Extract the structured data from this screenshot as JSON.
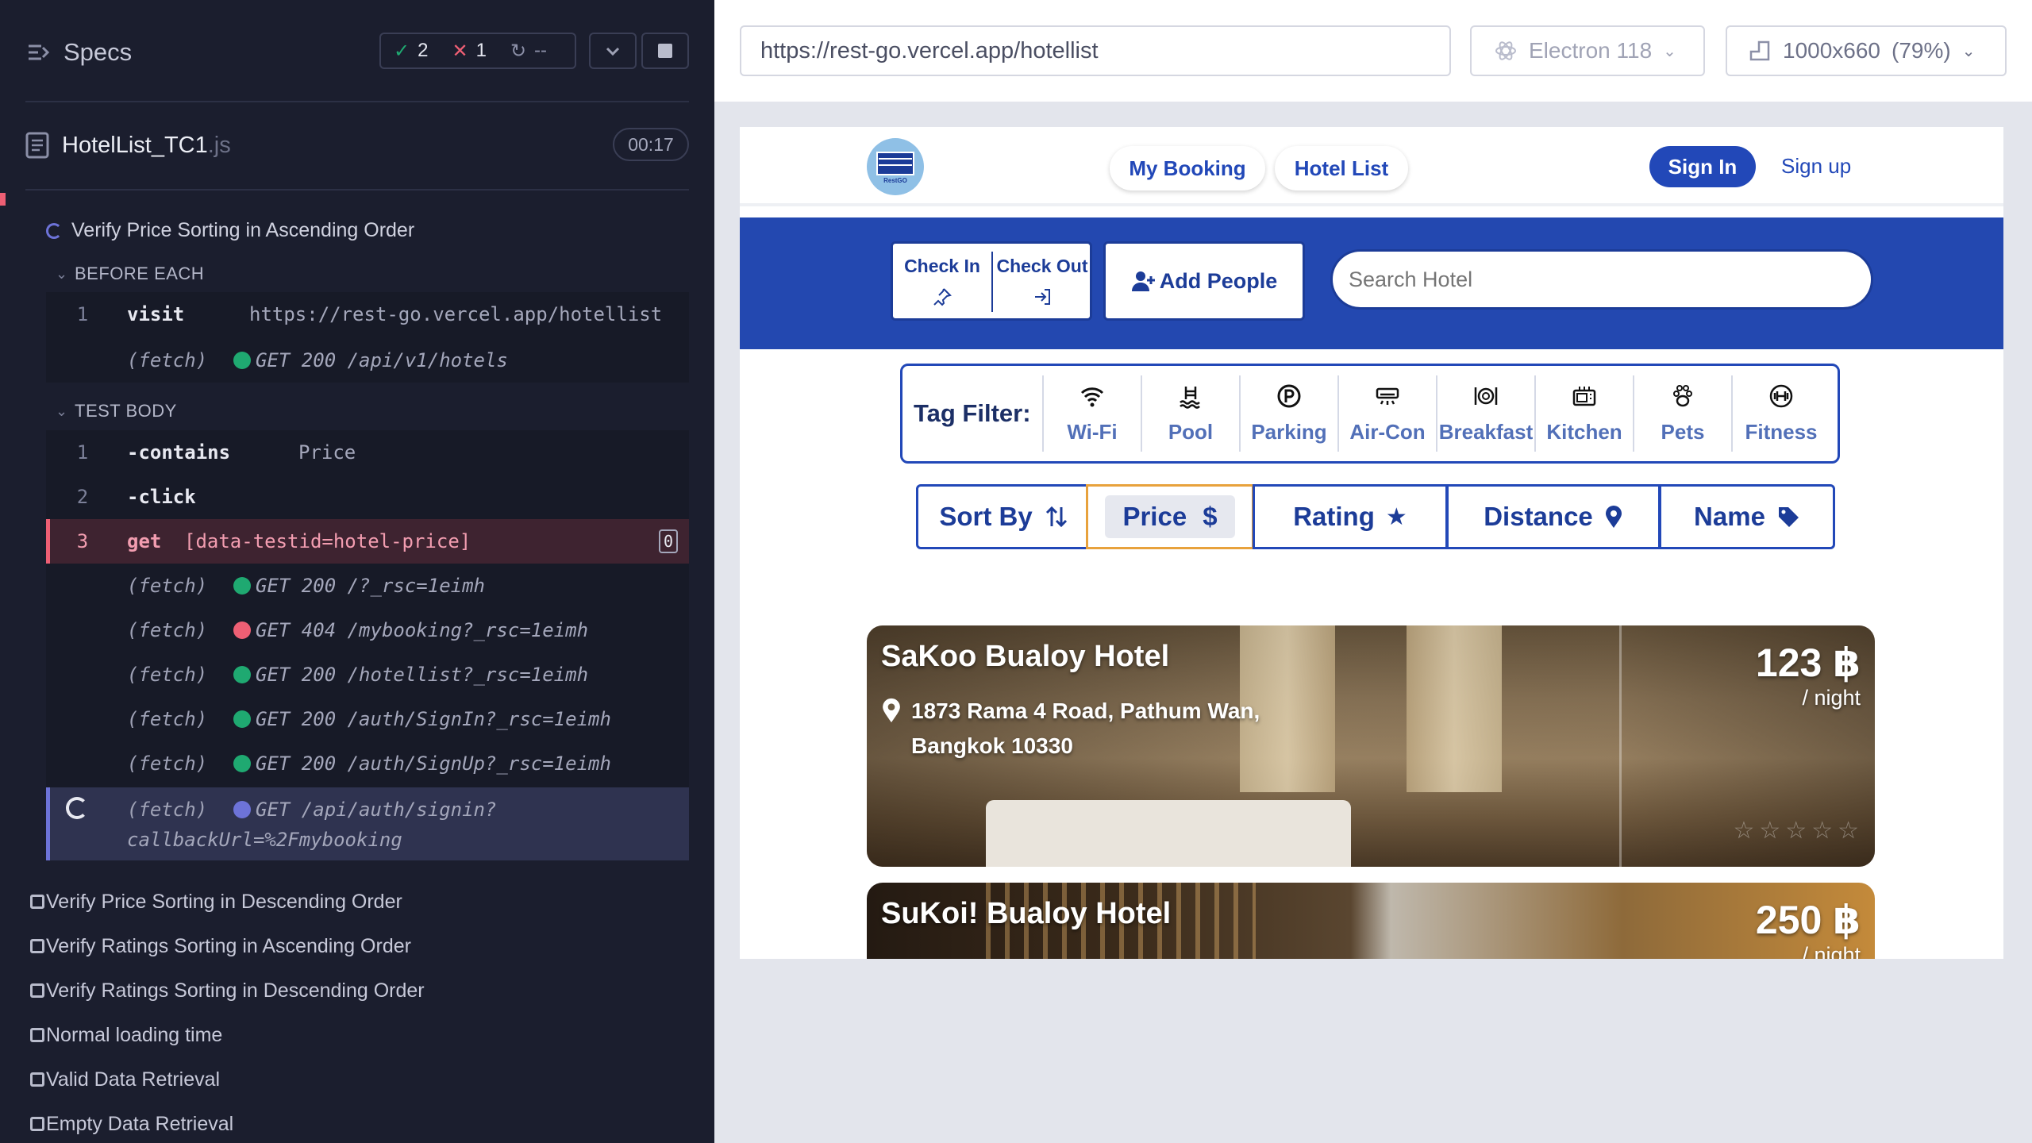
{
  "runner": {
    "specs_label": "Specs",
    "stats": {
      "passed": "2",
      "failed": "1",
      "pending": "--"
    },
    "spec_file": {
      "name": "HotelList_TC1",
      "ext": ".js"
    },
    "timer": "00:17",
    "current_test": "Verify Price Sorting in Ascending Order",
    "sections": {
      "before_each": "BEFORE EACH",
      "test_body": "TEST BODY"
    },
    "before_each_cmds": [
      {
        "num": "1",
        "name": "visit",
        "msg": "https://rest-go.vercel.app/hotellist"
      },
      {
        "num": "",
        "name": "(fetch)",
        "msg": "GET 200 /api/v1/hotels",
        "status": "ok"
      }
    ],
    "test_body_cmds": [
      {
        "num": "1",
        "name": "-contains",
        "msg": "Price"
      },
      {
        "num": "2",
        "name": "-click",
        "msg": ""
      },
      {
        "num": "3",
        "name": "get",
        "msg": "[data-testid=hotel-price]",
        "badge": "0"
      },
      {
        "num": "",
        "name": "(fetch)",
        "msg": "GET 200 /?_rsc=1eimh",
        "status": "ok"
      },
      {
        "num": "",
        "name": "(fetch)",
        "msg": "GET 404 /mybooking?_rsc=1eimh",
        "status": "err"
      },
      {
        "num": "",
        "name": "(fetch)",
        "msg": "GET 200 /hotellist?_rsc=1eimh",
        "status": "ok"
      },
      {
        "num": "",
        "name": "(fetch)",
        "msg": "GET 200 /auth/SignIn?_rsc=1eimh",
        "status": "ok"
      },
      {
        "num": "",
        "name": "(fetch)",
        "msg": "GET 200 /auth/SignUp?_rsc=1eimh",
        "status": "ok"
      },
      {
        "num": "",
        "name": "(fetch)",
        "msg": "GET /api/auth/signin?",
        "msg2": "callbackUrl=%2Fmybooking",
        "status": "pending"
      }
    ],
    "pending_tests": [
      "Verify Price Sorting in Descending Order",
      "Verify Ratings Sorting in Ascending Order",
      "Verify Ratings Sorting in Descending Order",
      "Normal loading time",
      "Valid Data Retrieval",
      "Empty Data Retrieval"
    ],
    "colors": {
      "pass": "#1fa971",
      "fail": "#ee5f74",
      "pending": "#6d73d8"
    }
  },
  "browser": {
    "url": "https://rest-go.vercel.app/hotellist",
    "engine": "Electron 118",
    "viewport": "1000x660",
    "zoom": "(79%)"
  },
  "app": {
    "logo_text": "RestGO",
    "nav": {
      "my_booking": "My Booking",
      "hotel_list": "Hotel List",
      "sign_in": "Sign In",
      "sign_up": "Sign up"
    },
    "check_in": "Check In",
    "check_out": "Check Out",
    "add_people": "Add People",
    "search_placeholder": "Search Hotel",
    "tag_filter_label": "Tag Filter:",
    "tags": [
      {
        "label": "Wi-Fi",
        "icon": "wifi-icon"
      },
      {
        "label": "Pool",
        "icon": "pool-icon"
      },
      {
        "label": "Parking",
        "icon": "parking-icon"
      },
      {
        "label": "Air-Con",
        "icon": "aircon-icon"
      },
      {
        "label": "Breakfast",
        "icon": "breakfast-icon"
      },
      {
        "label": "Kitchen",
        "icon": "kitchen-icon"
      },
      {
        "label": "Pets",
        "icon": "paw-icon"
      },
      {
        "label": "Fitness",
        "icon": "dumbbell-icon"
      }
    ],
    "sort": {
      "label": "Sort By",
      "options": [
        {
          "label": "Price",
          "icon": "$"
        },
        {
          "label": "Rating",
          "icon": "★"
        },
        {
          "label": "Distance",
          "icon": "pin"
        },
        {
          "label": "Name",
          "icon": "tag"
        }
      ]
    },
    "hotels": [
      {
        "name": "SaKoo Bualoy Hotel",
        "address_line1": "1873 Rama 4 Road, Pathum Wan,",
        "address_line2": "Bangkok 10330",
        "price": "123 ฿",
        "per": "/ night"
      },
      {
        "name": "SuKoi! Bualoy Hotel",
        "price": "250 ฿",
        "per": "/ night"
      }
    ],
    "brand_color": "#2248b8"
  }
}
